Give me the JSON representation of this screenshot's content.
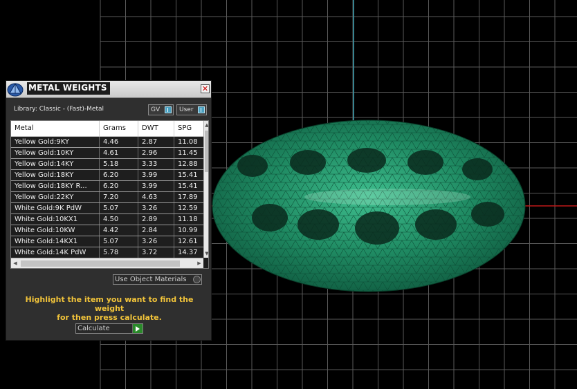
{
  "panel": {
    "title": "METAL WEIGHTS",
    "close_symbol": "✕",
    "library_label": "Library: Classic - (Fast)-Metal",
    "toggles": [
      {
        "label": "GV"
      },
      {
        "label": "User"
      }
    ],
    "table": {
      "columns": [
        "Metal",
        "Grams",
        "DWT",
        "SPG"
      ],
      "rows": [
        [
          "Yellow Gold:9KY",
          "4.46",
          "2.87",
          "11.08"
        ],
        [
          "Yellow Gold:10KY",
          "4.61",
          "2.96",
          "11.45"
        ],
        [
          "Yellow Gold:14KY",
          "5.18",
          "3.33",
          "12.88"
        ],
        [
          "Yellow Gold:18KY",
          "6.20",
          "3.99",
          "15.41"
        ],
        [
          "Yellow Gold:18KY R...",
          "6.20",
          "3.99",
          "15.41"
        ],
        [
          "Yellow Gold:22KY",
          "7.20",
          "4.63",
          "17.89"
        ],
        [
          "White Gold:9K PdW",
          "5.07",
          "3.26",
          "12.59"
        ],
        [
          "White Gold:10KX1",
          "4.50",
          "2.89",
          "11.18"
        ],
        [
          "White Gold:10KW",
          "4.42",
          "2.84",
          "10.99"
        ],
        [
          "White Gold:14KX1",
          "5.07",
          "3.26",
          "12.61"
        ],
        [
          "White Gold:14K PdW",
          "5.78",
          "3.72",
          "14.37"
        ]
      ]
    },
    "use_object_materials_label": "Use Object Materials",
    "hint_line1": "Highlight the item you want to find the weight",
    "hint_line2": "for then press calculate.",
    "calculate_label": "Calculate"
  },
  "viewport": {
    "background": "#000000",
    "grid_color": "#5a5a5a",
    "axis_x_color": "#c01818",
    "axis_y_color": "#3aa0b0",
    "mesh_color": "#1e8a60"
  }
}
